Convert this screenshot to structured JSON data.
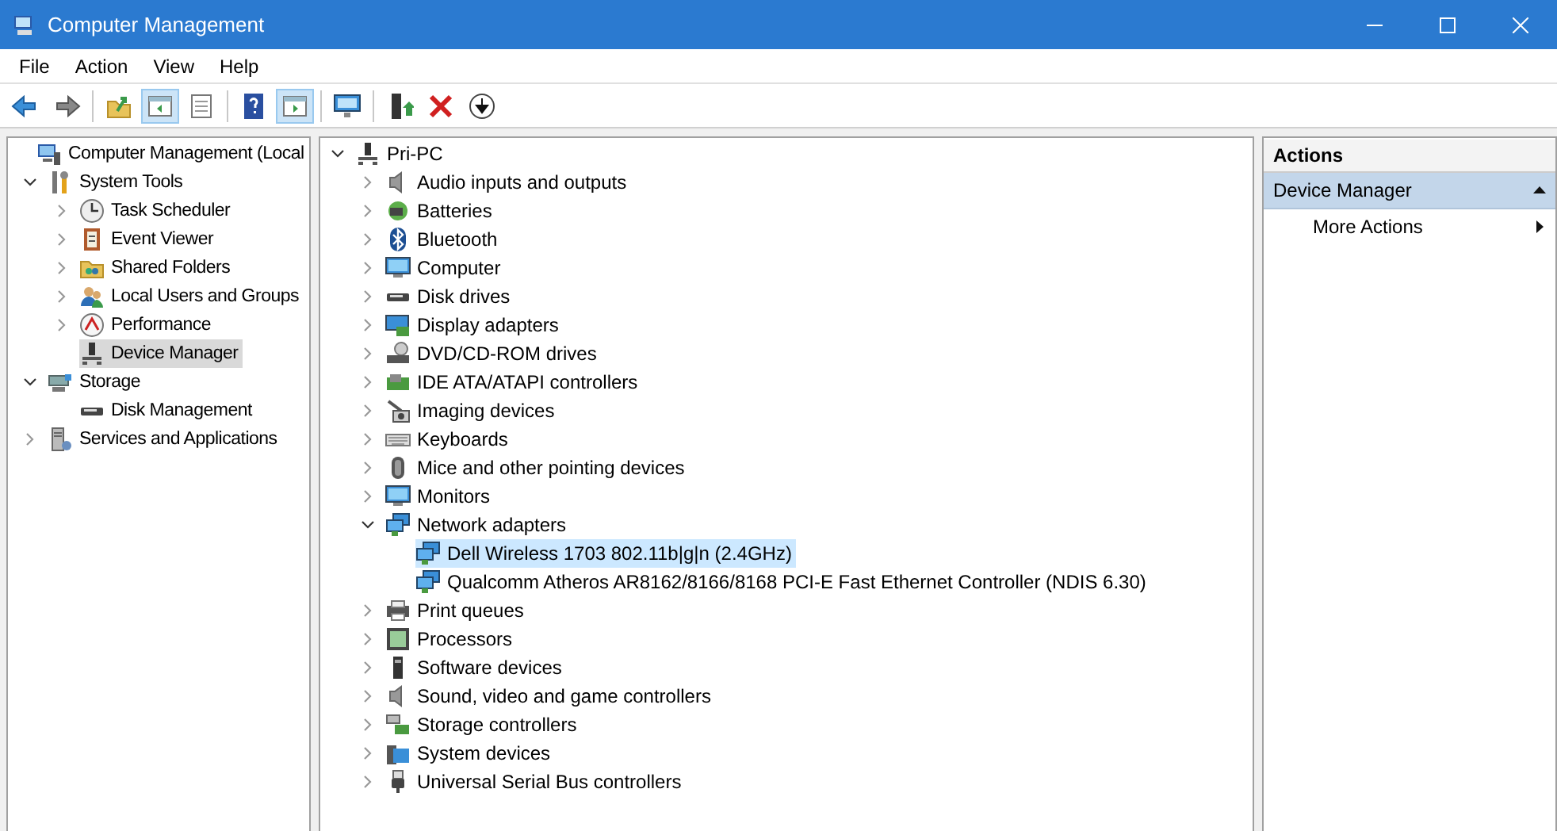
{
  "window": {
    "title": "Computer Management"
  },
  "menu": [
    "File",
    "Action",
    "View",
    "Help"
  ],
  "toolbar": [
    {
      "pressed": false
    },
    {
      "pressed": false
    },
    {
      "pressed": false
    },
    {
      "pressed": true
    },
    {
      "pressed": false
    },
    {
      "pressed": false
    },
    {
      "pressed": true
    },
    {
      "pressed": false
    },
    {
      "pressed": false
    },
    {
      "pressed": false
    },
    {
      "pressed": false
    }
  ],
  "console_tree": {
    "items": [
      {
        "label": "Computer Management (Local",
        "selected": false,
        "children": [
          {
            "label": "System Tools",
            "expanded": true,
            "selected": false,
            "children": [
              {
                "label": "Task Scheduler",
                "expanded": false,
                "selected": false
              },
              {
                "label": "Event Viewer",
                "expanded": false,
                "selected": false
              },
              {
                "label": "Shared Folders",
                "expanded": false,
                "selected": false
              },
              {
                "label": "Local Users and Groups",
                "expanded": false,
                "selected": false
              },
              {
                "label": "Performance",
                "expanded": false,
                "selected": false
              },
              {
                "label": "Device Manager",
                "selected": true
              }
            ]
          },
          {
            "label": "Storage",
            "expanded": true,
            "selected": false,
            "children": [
              {
                "label": "Disk Management",
                "selected": false
              }
            ]
          },
          {
            "label": "Services and Applications",
            "expanded": false,
            "selected": false
          }
        ]
      }
    ]
  },
  "device_tree": {
    "items": [
      {
        "label": "Pri-PC",
        "expanded": true,
        "selected": false,
        "children": [
          {
            "label": "Audio inputs and outputs",
            "expanded": false,
            "selected": false
          },
          {
            "label": "Batteries",
            "expanded": false,
            "selected": false
          },
          {
            "label": "Bluetooth",
            "expanded": false,
            "selected": false
          },
          {
            "label": "Computer",
            "expanded": false,
            "selected": false
          },
          {
            "label": "Disk drives",
            "expanded": false,
            "selected": false
          },
          {
            "label": "Display adapters",
            "expanded": false,
            "selected": false
          },
          {
            "label": "DVD/CD-ROM drives",
            "expanded": false,
            "selected": false
          },
          {
            "label": "IDE ATA/ATAPI controllers",
            "expanded": false,
            "selected": false
          },
          {
            "label": "Imaging devices",
            "expanded": false,
            "selected": false
          },
          {
            "label": "Keyboards",
            "expanded": false,
            "selected": false
          },
          {
            "label": "Mice and other pointing devices",
            "expanded": false,
            "selected": false
          },
          {
            "label": "Monitors",
            "expanded": false,
            "selected": false
          },
          {
            "label": "Network adapters",
            "expanded": true,
            "selected": false,
            "children": [
              {
                "label": "Dell Wireless 1703 802.11b|g|n (2.4GHz)",
                "selected": true
              },
              {
                "label": "Qualcomm Atheros AR8162/8166/8168 PCI-E Fast Ethernet Controller (NDIS 6.30)",
                "selected": false
              }
            ]
          },
          {
            "label": "Print queues",
            "expanded": false,
            "selected": false
          },
          {
            "label": "Processors",
            "expanded": false,
            "selected": false
          },
          {
            "label": "Software devices",
            "expanded": false,
            "selected": false
          },
          {
            "label": "Sound, video and game controllers",
            "expanded": false,
            "selected": false
          },
          {
            "label": "Storage controllers",
            "expanded": false,
            "selected": false
          },
          {
            "label": "System devices",
            "expanded": false,
            "selected": false
          },
          {
            "label": "Universal Serial Bus controllers",
            "expanded": false,
            "selected": false
          }
        ]
      }
    ]
  },
  "actions": {
    "title": "Actions",
    "sections": [
      {
        "label": "Device Manager",
        "expanded": true,
        "items": [
          "More Actions"
        ]
      }
    ]
  }
}
